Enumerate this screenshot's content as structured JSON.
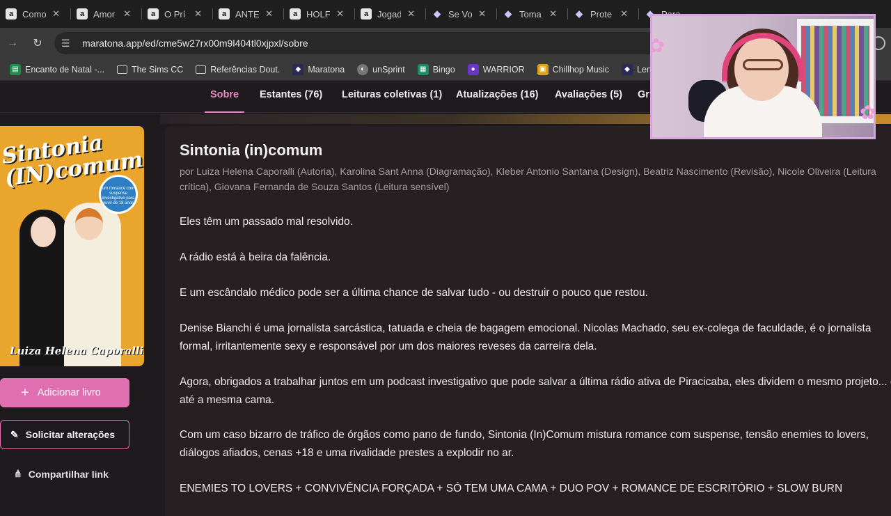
{
  "tabs": [
    {
      "title": "Como",
      "fav": "a",
      "type": "amz"
    },
    {
      "title": "Amor",
      "fav": "a",
      "type": "amz"
    },
    {
      "title": "O Prí",
      "fav": "a",
      "type": "amz"
    },
    {
      "title": "ANTE",
      "fav": "a",
      "type": "amz"
    },
    {
      "title": "HOLF",
      "fav": "a",
      "type": "amz"
    },
    {
      "title": "Jogad",
      "fav": "a",
      "type": "amz"
    },
    {
      "title": "Se Vo",
      "fav": "cat",
      "type": "cat"
    },
    {
      "title": "Toma",
      "fav": "cat",
      "type": "cat"
    },
    {
      "title": "Prote",
      "fav": "cat",
      "type": "cat"
    },
    {
      "title": "Para",
      "fav": "cat",
      "type": "cat"
    }
  ],
  "addressbar": {
    "url": "maratona.app/ed/cme5w27rx00m9l404tl0xjpxl/sobre"
  },
  "bookmarks": [
    {
      "label": "Encanto de Natal -...",
      "color": "#1e8c4a"
    },
    {
      "label": "The Sims CC",
      "color": "folder"
    },
    {
      "label": "Referências Dout.",
      "color": "folder"
    },
    {
      "label": "Maratona",
      "color": "#2b2b55"
    },
    {
      "label": "unSprint",
      "color": "#777"
    },
    {
      "label": "Bingo",
      "color": "#1f8a66"
    },
    {
      "label": "WARRIOR",
      "color": "#6a35c7"
    },
    {
      "label": "Chillhop Music",
      "color": "#d9a21b"
    },
    {
      "label": "Lendo Po",
      "color": "#2b2b55"
    }
  ],
  "subnav": {
    "sobre": "Sobre",
    "estantes": "Estantes (76)",
    "leituras": "Leituras coletivas (1)",
    "atualizacoes": "Atualizações (16)",
    "avaliacoes": "Avaliações (5)",
    "grupos": "Gr"
  },
  "cover": {
    "title_line1": "Sintonia",
    "title_line2": "(IN)comum",
    "seal": "um romance com suspense investigativo para ouvir de 18 anos",
    "author": "Luiza Helena Caporalli"
  },
  "actions": {
    "add": "Adicionar livro",
    "request": "Solicitar alterações",
    "share": "Compartilhar link"
  },
  "book": {
    "title": "Sintonia (in)comum",
    "credits": "por Luiza Helena Caporalli (Autoria), Karolina Sant Anna (Diagramação), Kleber Antonio Santana (Design), Beatriz Nascimento (Revisão), Nicole Oliveira (Leitura crítica), Giovana Fernanda de Souza Santos (Leitura sensível)",
    "paragraphs": [
      "Eles têm um passado mal resolvido.",
      "A rádio está à beira da falência.",
      "E um escândalo médico pode ser a última chance de salvar tudo - ou destruir o pouco que restou.",
      "Denise Bianchi é uma jornalista sarcástica, tatuada e cheia de bagagem emocional. Nicolas Machado, seu ex-colega de faculdade, é o jornalista formal, irritantemente sexy e responsável por um dos maiores reveses da carreira dela.",
      "Agora, obrigados a trabalhar juntos em um podcast investigativo que pode salvar a última rádio ativa de Piracicaba, eles dividem o mesmo projeto... e até a mesma cama.",
      "Com um caso bizarro de tráfico de órgãos como pano de fundo, Sintonia (In)Comum mistura romance com suspense, tensão enemies to lovers, diálogos afiados, cenas +18 e uma rivalidade prestes a explodir no ar.",
      "ENEMIES TO LOVERS + CONVIVÊNCIA FORÇADA + SÓ TEM UMA CAMA + DUO POV + ROMANCE DE ESCRITÓRIO + SLOW BURN"
    ]
  },
  "colors": {
    "accent": "#e06fb2",
    "accent_text": "#e889c4"
  }
}
